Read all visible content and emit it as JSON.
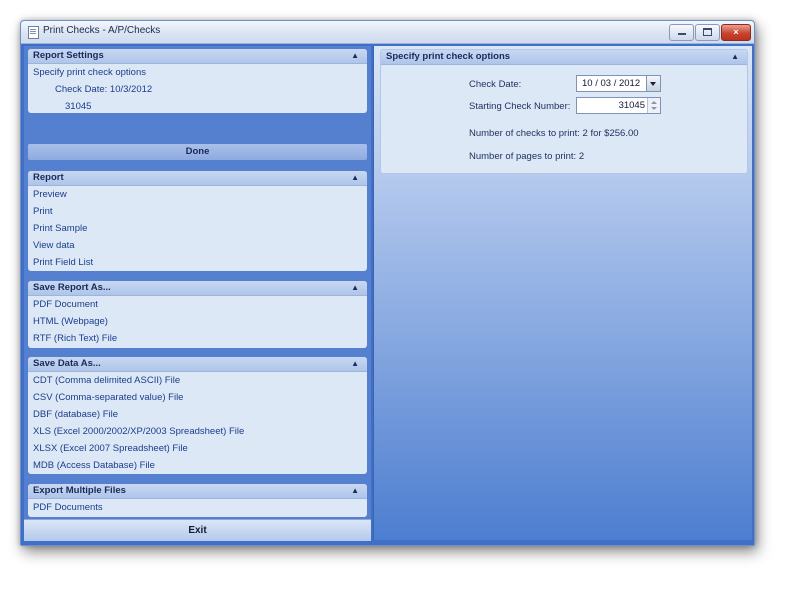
{
  "window": {
    "title": "Print Checks - A/P/Checks",
    "buttons": {
      "close": "×"
    }
  },
  "report_settings": {
    "header": "Report Settings",
    "description": "Specify print check options",
    "check_date_label": "Check Date:",
    "check_date_value": "10/3/2012",
    "check_number": "31045"
  },
  "done_label": "Done",
  "report": {
    "header": "Report",
    "items": [
      "Preview",
      "Print",
      "Print Sample",
      "View data",
      "Print Field List"
    ]
  },
  "save_report_as": {
    "header": "Save Report As...",
    "items": [
      "PDF Document",
      "HTML (Webpage)",
      "RTF (Rich Text) File"
    ]
  },
  "save_data_as": {
    "header": "Save Data As...",
    "items": [
      "CDT (Comma delimited ASCII) File",
      "CSV (Comma-separated value) File",
      "DBF (database) File",
      "XLS (Excel 2000/2002/XP/2003 Spreadsheet) File",
      "XLSX (Excel 2007 Spreadsheet) File",
      "MDB (Access Database) File"
    ]
  },
  "export_multiple": {
    "header": "Export Multiple Files",
    "items": [
      "PDF Documents"
    ]
  },
  "exit_label": "Exit",
  "options": {
    "header": "Specify print check options",
    "check_date_label": "Check Date:",
    "check_date_value": "10 / 03 / 2012",
    "starting_number_label": "Starting Check Number:",
    "starting_number_value": "31045",
    "checks_to_print_label": "Number of checks to print:",
    "checks_to_print_value": "2 for $256.00",
    "pages_to_print_label": "Number of pages to print:",
    "pages_to_print_value": "2"
  },
  "icons": {
    "collapse": "chevron-double-up-icon",
    "app": "document-icon"
  },
  "colors": {
    "window_blue": "#3f6fc6",
    "panel_light": "#dde8f7",
    "link_text": "#1a3d8c"
  }
}
